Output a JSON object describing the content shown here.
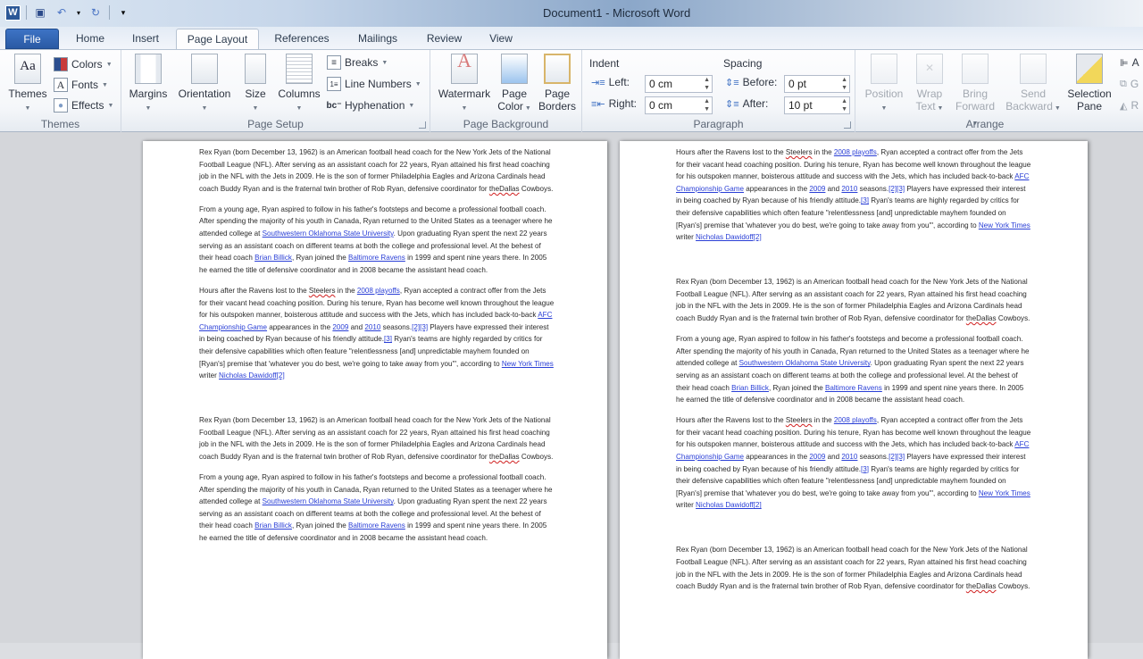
{
  "window": {
    "title": "Document1  -  Microsoft Word"
  },
  "qat": [
    {
      "name": "word-logo-icon",
      "glyph": "W"
    },
    {
      "name": "save-icon",
      "glyph": "💾"
    },
    {
      "name": "undo-icon",
      "glyph": "↶"
    },
    {
      "name": "undo-dropdown-icon",
      "glyph": "▾"
    },
    {
      "name": "redo-icon",
      "glyph": "↻"
    },
    {
      "name": "customize-qat-icon",
      "glyph": "▾"
    }
  ],
  "tabs": [
    "File",
    "Home",
    "Insert",
    "Page Layout",
    "References",
    "Mailings",
    "Review",
    "View"
  ],
  "active_tab": "Page Layout",
  "ribbon": {
    "themes": {
      "group_label": "Themes",
      "themes_btn": "Themes",
      "colors": "Colors",
      "fonts": "Fonts",
      "effects": "Effects"
    },
    "page_setup": {
      "group_label": "Page Setup",
      "margins": "Margins",
      "orientation": "Orientation",
      "size": "Size",
      "columns": "Columns",
      "breaks": "Breaks",
      "line_numbers": "Line Numbers",
      "hyphenation": "Hyphenation"
    },
    "page_background": {
      "group_label": "Page Background",
      "watermark": "Watermark",
      "page_color_1": "Page",
      "page_color_2": "Color",
      "page_borders_1": "Page",
      "page_borders_2": "Borders"
    },
    "paragraph": {
      "group_label": "Paragraph",
      "indent_title": "Indent",
      "left_label": "Left:",
      "left_value": "0 cm",
      "right_label": "Right:",
      "right_value": "0 cm",
      "spacing_title": "Spacing",
      "before_label": "Before:",
      "before_value": "0 pt",
      "after_label": "After:",
      "after_value": "10 pt"
    },
    "arrange": {
      "group_label": "Arrange",
      "position": "Position",
      "wrap_1": "Wrap",
      "wrap_2": "Text",
      "bring_1": "Bring",
      "bring_2": "Forward",
      "send_1": "Send",
      "send_2": "Backward",
      "selection_1": "Selection",
      "selection_2": "Pane",
      "align": "A",
      "group": "G",
      "rotate": "R"
    }
  },
  "document": {
    "p1": {
      "text": "Rex Ryan (born December 13, 1962) is an American football head coach for the New York Jets of the National Football League (NFL). After serving as an assistant coach for 22 years, Ryan attained his first head coaching job in the NFL with the Jets in 2009. He is the son of former Philadelphia Eagles and Arizona Cardinals head coach Buddy Ryan and is the fraternal twin brother of Rob Ryan, defensive coordinator for ",
      "squiggle": "theDallas",
      "tail": " Cowboys."
    },
    "p2": {
      "a": "From a young age, Ryan aspired to follow in his father's footsteps and become a professional football coach. After spending the majority of his youth in Canada, Ryan returned to the United States as a teenager where he attended college at ",
      "link1": "Southwestern Oklahoma State University",
      "b": ". Upon graduating Ryan spent the next 22 years serving as an assistant coach on different teams at both the college and professional level. At the behest of their head coach ",
      "link2": "Brian Billick",
      "c": ", Ryan joined the ",
      "link3": "Baltimore Ravens",
      "d": " in 1999 and spent nine years there. In 2005 he earned the title of defensive coordinator and in 2008 became the assistant head coach."
    },
    "p3": {
      "a": "Hours after the Ravens lost to the ",
      "squiggle": "Steelers",
      "b": " in the ",
      "link1": "2008 playoffs",
      "c": ", Ryan accepted a contract offer from the Jets for their vacant head coaching position. During his tenure, Ryan has become well known throughout the league for his outspoken manner, boisterous attitude and success with the Jets, which has included back-to-back ",
      "link2": "AFC Championship Game",
      "d": " appearances in the ",
      "link3": "2009",
      "e": " and ",
      "link4": "2010",
      "f": " seasons.",
      "link5": "[2][3]",
      "g": " Players have expressed their interest in being coached by Ryan because of his friendly attitude.",
      "link6": "[3]",
      "h": " Ryan's teams are highly regarded by critics for their defensive capabilities which often feature \"relentlessness [and] unpredictable mayhem founded on [Ryan's] premise that 'whatever you do best, we're going to take away from you'\", according to ",
      "link7": "New York Times",
      "i": " writer ",
      "link8": "Nicholas Dawidoff",
      "link9": "[2]"
    }
  }
}
